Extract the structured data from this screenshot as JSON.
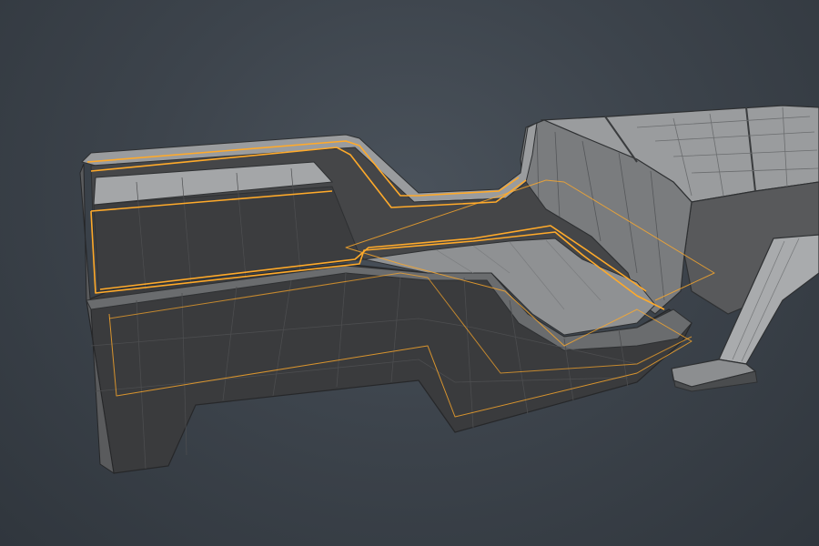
{
  "viewport": {
    "background": "#3d444c",
    "mesh_color": "#6a6c6e",
    "wire_color": "#3a3c3e",
    "selection_color": "#ffaa2a"
  },
  "scene": {
    "object": "hard-surface-mesh",
    "selected_edge_loops": 4
  }
}
